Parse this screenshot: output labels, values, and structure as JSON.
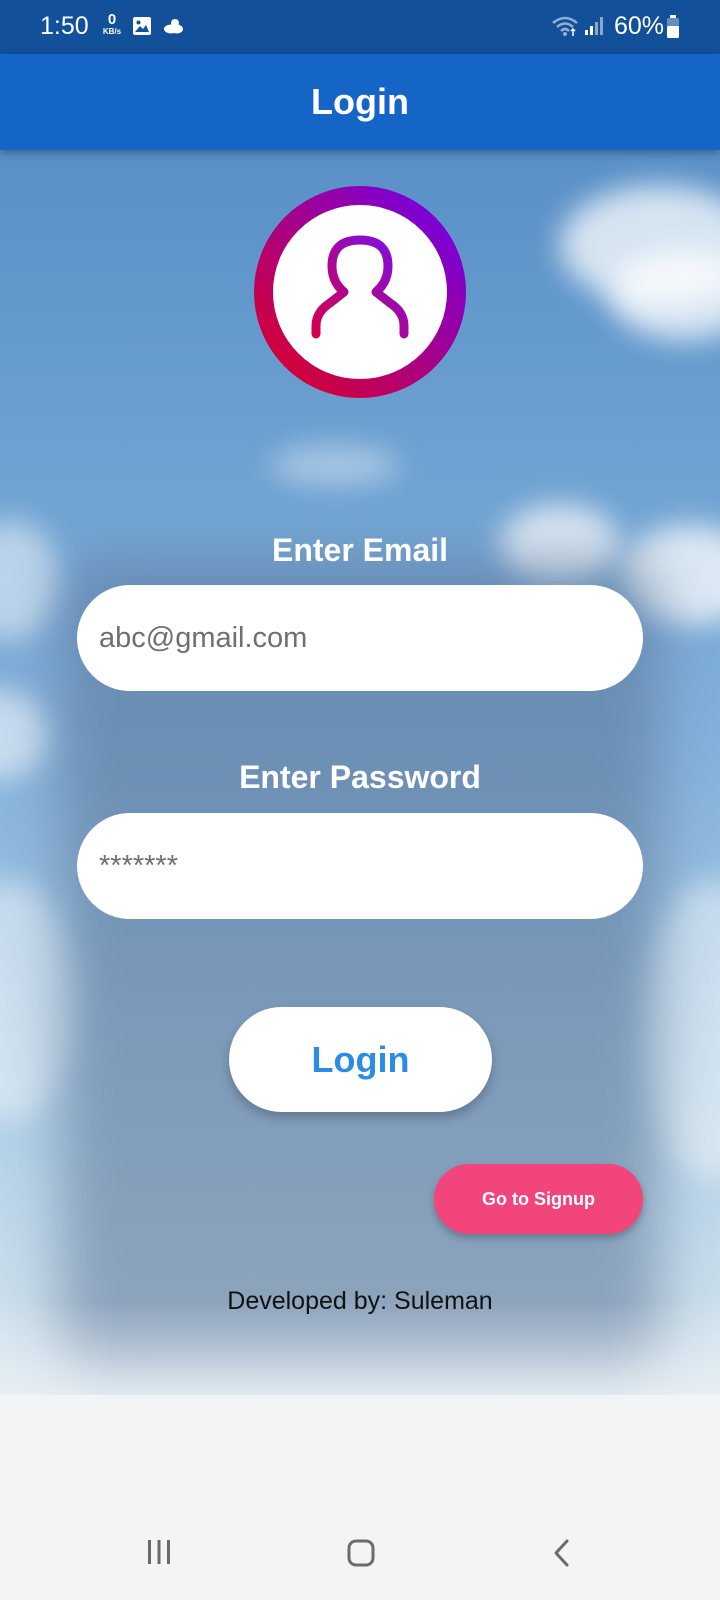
{
  "status_bar": {
    "time": "1:50",
    "net_speed_value": "0",
    "net_speed_unit": "KB/s",
    "battery": "60%",
    "icons": [
      "gallery-icon",
      "weather-icon",
      "wifi-icon",
      "signal-icon",
      "battery-icon"
    ]
  },
  "app_bar": {
    "title": "Login"
  },
  "avatar": {
    "icon": "user-icon",
    "ring_colors": [
      "#e3001b",
      "#6a00f4"
    ]
  },
  "form": {
    "email_label": "Enter Email",
    "email_placeholder": "abc@gmail.com",
    "password_label": "Enter Password",
    "password_placeholder": "*******",
    "login_label": "Login",
    "signup_label": "Go to Signup"
  },
  "footer": {
    "developer": "Developed by: Suleman"
  },
  "nav_bar": {
    "icons": [
      "recents-icon",
      "home-icon",
      "back-icon"
    ]
  },
  "colors": {
    "status_bar": "#12509a",
    "app_bar": "#1565c7",
    "login_text": "#2b8ce8",
    "signup_button": "#f2457c"
  }
}
